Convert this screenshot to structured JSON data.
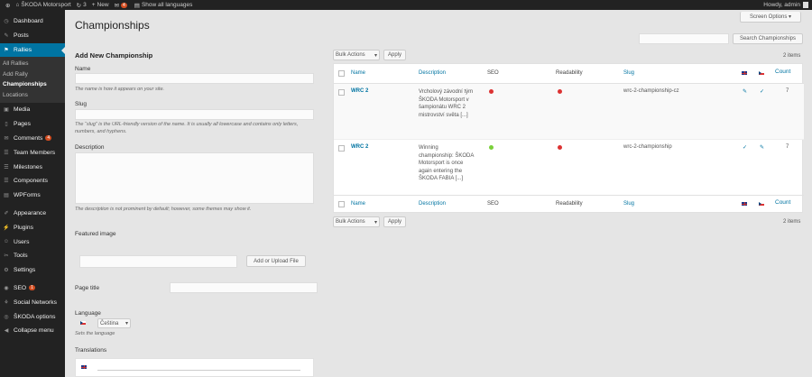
{
  "adminbar": {
    "wp_icon": "wordpress-icon",
    "site_name": "ŠKODA Motorsport",
    "updates_count": "3",
    "new_label": "New",
    "comments_count": "4",
    "translations_label": "Show all languages",
    "account": "Howdy, admin"
  },
  "sidebar": {
    "items": [
      {
        "label": "Dashboard",
        "icon": "dashboard-icon"
      },
      {
        "label": "Posts",
        "icon": "posts-icon"
      },
      {
        "label": "Rallies",
        "icon": "rallies-icon",
        "active": true
      },
      {
        "label": "Media",
        "icon": "media-icon"
      },
      {
        "label": "Pages",
        "icon": "pages-icon"
      },
      {
        "label": "Comments",
        "icon": "comments-icon",
        "badge": "4"
      },
      {
        "label": "Team Members",
        "icon": "team-icon"
      },
      {
        "label": "Milestones",
        "icon": "milestones-icon"
      },
      {
        "label": "Components",
        "icon": "components-icon"
      },
      {
        "label": "WPForms",
        "icon": "wpforms-icon"
      },
      {
        "label": "Appearance",
        "icon": "appearance-icon"
      },
      {
        "label": "Plugins",
        "icon": "plugins-icon"
      },
      {
        "label": "Users",
        "icon": "users-icon"
      },
      {
        "label": "Tools",
        "icon": "tools-icon"
      },
      {
        "label": "Settings",
        "icon": "settings-icon"
      },
      {
        "label": "SEO",
        "icon": "seo-icon",
        "badge": "1"
      },
      {
        "label": "Social Networks",
        "icon": "social-icon"
      },
      {
        "label": "ŠKODA options",
        "icon": "options-icon"
      },
      {
        "label": "Collapse menu",
        "icon": "collapse-icon"
      }
    ],
    "rallies_sub": [
      "All Rallies",
      "Add Rally",
      "Championships",
      "Locations"
    ]
  },
  "page": {
    "title": "Championships",
    "screen_options": "Screen Options ▾",
    "search_button": "Search Championships"
  },
  "form": {
    "heading": "Add New Championship",
    "name_label": "Name",
    "name_desc": "The name is how it appears on your site.",
    "slug_label": "Slug",
    "slug_desc": "The “slug” is the URL-friendly version of the name. It is usually all lowercase and contains only letters, numbers, and hyphens.",
    "description_label": "Description",
    "description_desc": "The description is not prominent by default; however, some themes may show it.",
    "featured_label": "Featured image",
    "add_image_button": "Add or Upload File",
    "page_title_label": "Page title",
    "language_label": "Language",
    "language_value": "Čeština",
    "language_desc": "Sets the language",
    "translations_label": "Translations"
  },
  "bulk": {
    "top_label": "Bulk Actions",
    "bottom_label": "Bulk Actions",
    "apply": "Apply",
    "items_top": "2 items",
    "items_bottom": "2 items"
  },
  "table": {
    "columns": [
      "Name",
      "Description",
      "SEO",
      "Readability",
      "Slug",
      "Count"
    ],
    "rows": [
      {
        "name": "WRC 2",
        "description": "Vrcholový závodní tým ŠKODA Motorsport v šampionátu WRC 2 mistrovství světa [...]",
        "seo": "#dc3232",
        "readability": "#dc3232",
        "slug": "wrc-2-championship-cz",
        "count": "7"
      },
      {
        "name": "WRC 2",
        "description": "Winning championship: ŠKODA Motorsport is once again entering the ŠKODA FABIA [...]",
        "seo": "#7ad03a",
        "readability": "#dc3232",
        "slug": "wrc-2-championship",
        "count": "7"
      }
    ]
  }
}
